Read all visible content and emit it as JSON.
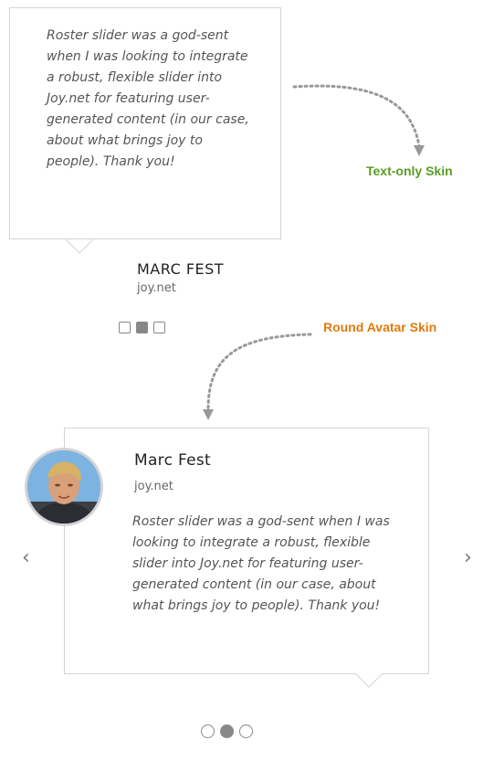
{
  "text_only_skin": {
    "quote": "Roster slider was a god-sent when I was looking to integrate a robust, flexible slider into Joy.net for featuring user-generated content (in our case, about what brings joy to people). Thank you!",
    "name": "MARC FEST",
    "site": "joy.net",
    "pager": {
      "count": 3,
      "active_index": 1,
      "shape": "square"
    }
  },
  "labels": {
    "text_only": "Text-only Skin",
    "round_avatar": "Round Avatar Skin"
  },
  "round_avatar_skin": {
    "name": "Marc Fest",
    "site": "joy.net",
    "quote": "Roster slider was a god-sent when I was looking to integrate a robust, flexible slider into Joy.net for featuring user-generated content (in our case, about what brings joy to people). Thank you!",
    "prev_arrow": "‹",
    "next_arrow": "›",
    "pager": {
      "count": 3,
      "active_index": 1,
      "shape": "circle"
    }
  },
  "colors": {
    "text_only_label": "#5a9d22",
    "round_avatar_label": "#e27a10",
    "border": "#d4d4d4",
    "pager": "#888888"
  }
}
